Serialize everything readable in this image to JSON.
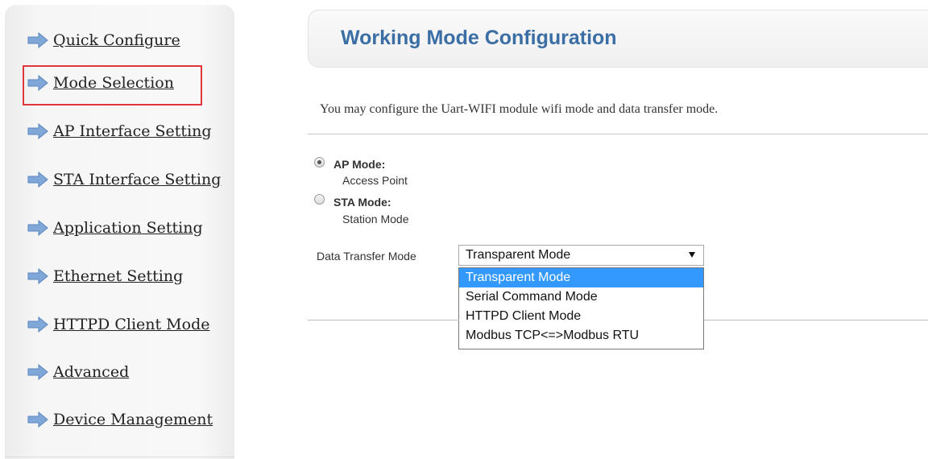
{
  "sidebar": {
    "items": [
      {
        "label": "Quick Configure"
      },
      {
        "label": "Mode Selection"
      },
      {
        "label": "AP Interface Setting"
      },
      {
        "label": "STA Interface Setting"
      },
      {
        "label": "Application Setting"
      },
      {
        "label": "Ethernet Setting"
      },
      {
        "label": "HTTPD Client Mode"
      },
      {
        "label": "Advanced"
      },
      {
        "label": "Device Management"
      }
    ],
    "selected_index": 1,
    "arrow_icon": "arrow-right-icon",
    "arrow_color": "#7fa7d8",
    "highlight_color": "#e0363b"
  },
  "header": {
    "title": "Working Mode Configuration",
    "title_color": "#3a6ea5"
  },
  "main": {
    "description": "You may configure the Uart-WIFI module wifi mode and data transfer mode.",
    "modes": [
      {
        "label": "AP Mode:",
        "sublabel": "Access Point",
        "checked": true
      },
      {
        "label": "STA Mode:",
        "sublabel": "Station Mode",
        "checked": false
      }
    ],
    "data_transfer": {
      "label": "Data Transfer Mode",
      "selected": "Transparent Mode",
      "options": [
        "Transparent Mode",
        "Serial Command Mode",
        "HTTPD Client Mode",
        "Modbus TCP<=>Modbus RTU"
      ],
      "highlight_color": "#3399ff"
    }
  }
}
